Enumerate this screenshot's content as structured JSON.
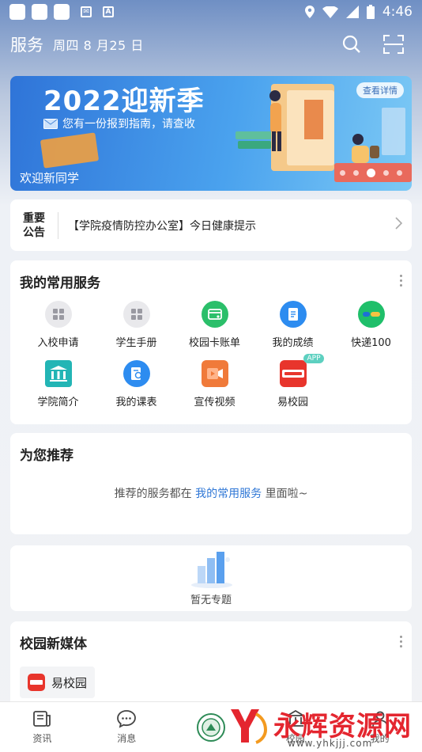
{
  "status_bar": {
    "time": "4:46",
    "notif_icons": [
      "app-icon",
      "app-icon",
      "app-icon",
      "mail-icon",
      "text-icon"
    ]
  },
  "header": {
    "title": "服务",
    "weekday": "周四",
    "date": "8 月25 日"
  },
  "banner": {
    "title": "2022迎新季",
    "subtitle": "您有一份报到指南，请查收",
    "caption": "欢迎新同学",
    "detail_label": "查看详情",
    "slide_count": 5,
    "active_slide": 3
  },
  "notice": {
    "tag_line1": "重要",
    "tag_line2": "公告",
    "text": "【学院疫情防控办公室】今日健康提示"
  },
  "services": {
    "title": "我的常用服务",
    "items": [
      {
        "label": "入校申请",
        "icon": "grid-icon",
        "color": "#e9e9ec"
      },
      {
        "label": "学生手册",
        "icon": "grid-icon",
        "color": "#e9e9ec"
      },
      {
        "label": "校园卡账单",
        "icon": "card-icon",
        "color": "#2bbf6a"
      },
      {
        "label": "我的成绩",
        "icon": "document-icon",
        "color": "#2d8cf0"
      },
      {
        "label": "快递100",
        "icon": "express-icon",
        "color": "#1fbf6a"
      },
      {
        "label": "学院简介",
        "icon": "building-icon",
        "color": "#23b5b5"
      },
      {
        "label": "我的课表",
        "icon": "schedule-icon",
        "color": "#2d8cf0"
      },
      {
        "label": "宣传视频",
        "icon": "video-icon",
        "color": "#f07a3a"
      },
      {
        "label": "易校园",
        "icon": "yixiaoyuan-logo",
        "color": "#e8352c",
        "badge": "APP"
      }
    ]
  },
  "recommend": {
    "title": "为您推荐",
    "text_before": "推荐的服务都在",
    "link": "我的常用服务",
    "text_after": "里面啦~"
  },
  "topics": {
    "empty_text": "暂无专题"
  },
  "media": {
    "title": "校园新媒体",
    "chip_label": "易校园"
  },
  "bottom_nav": [
    {
      "label": "资讯",
      "icon": "news-icon"
    },
    {
      "label": "消息",
      "icon": "chat-icon"
    },
    {
      "label": "",
      "icon": "school-emblem-icon"
    },
    {
      "label": "校园",
      "icon": "campus-icon"
    },
    {
      "label": "我的",
      "icon": "profile-icon"
    }
  ],
  "watermark": {
    "brand": "永辉资源网",
    "url": "www.yhkjjj.com"
  }
}
